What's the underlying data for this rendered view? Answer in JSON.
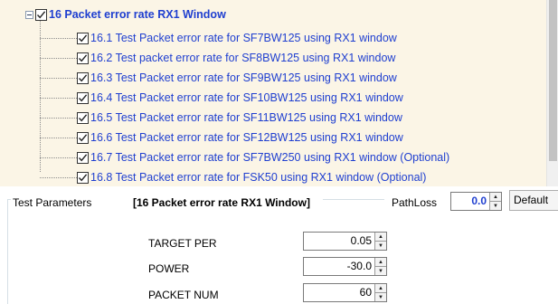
{
  "tree": {
    "parent": {
      "label": "16 Packet error rate RX1 Window",
      "checked": true,
      "expanded": true
    },
    "children": [
      {
        "label": "16.1 Test Packet error rate for SF7BW125 using RX1 window",
        "checked": true
      },
      {
        "label": "16.2 Test packet error rate for SF8BW125 using RX1 window",
        "checked": true
      },
      {
        "label": "16.3 Test Packet error rate for SF9BW125 using RX1 window",
        "checked": true
      },
      {
        "label": "16.4 Test Packet error rate for SF10BW125 using RX1 window",
        "checked": true
      },
      {
        "label": "16.5 Test Packet error rate for SF11BW125 using RX1 window",
        "checked": true
      },
      {
        "label": "16.6 Test Packet error rate for SF12BW125 using RX1 window",
        "checked": true
      },
      {
        "label": "16.7 Test Packet error rate for SF7BW250 using RX1 window (Optional)",
        "checked": true
      },
      {
        "label": "16.8 Test Packet error rate for FSK50 using RX1 window (Optional)",
        "checked": true
      }
    ]
  },
  "params": {
    "group_label": "Test Parameters",
    "title": "[16 Packet error rate RX1 Window]",
    "pathloss_label": "PathLoss",
    "pathloss_value": "0.0",
    "default_label": "Default",
    "rows": [
      {
        "label": "TARGET PER",
        "value": "0.05"
      },
      {
        "label": "POWER",
        "value": "-30.0"
      },
      {
        "label": "PACKET NUM",
        "value": "60"
      }
    ]
  },
  "colors": {
    "tree_bg": "#fbf5e6",
    "link_blue": "#1f3fd0",
    "scroll_thumb": "#c2c2c2"
  },
  "icons": {
    "expander": "collapse-minus-icon",
    "checkbox": "checkmark-icon",
    "spinner": "spin-up-down-icon"
  }
}
